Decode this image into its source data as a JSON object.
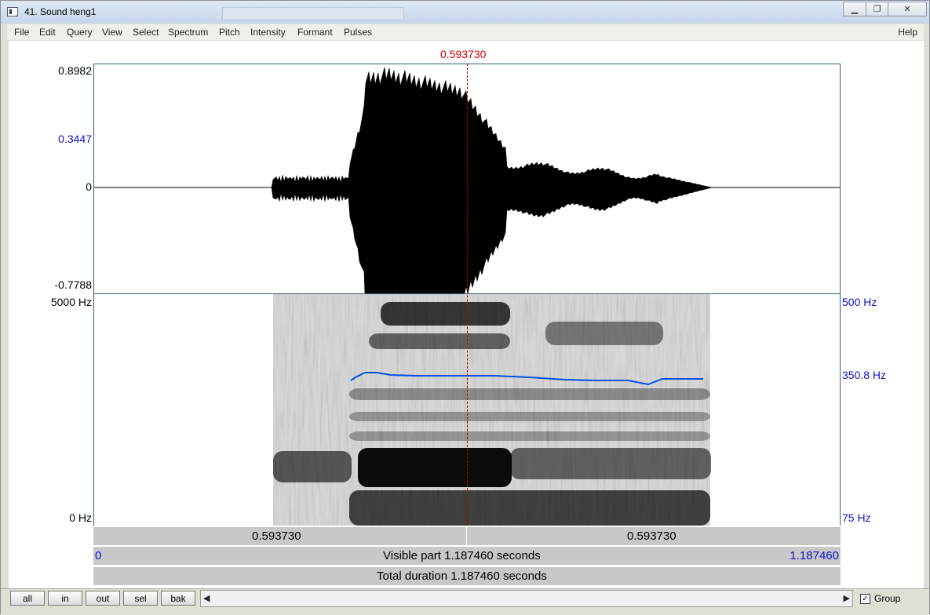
{
  "window": {
    "title": "41. Sound heng1",
    "controls": [
      "minimize",
      "restore",
      "close"
    ]
  },
  "menu": {
    "items": [
      "File",
      "Edit",
      "Query",
      "View",
      "Select",
      "Spectrum",
      "Pitch",
      "Intensity",
      "Formant",
      "Pulses"
    ],
    "help": "Help"
  },
  "cursor": {
    "time_label": "0.593730"
  },
  "waveform": {
    "y_max": "0.8982",
    "y_mid": "0.3447",
    "y_zero": "0",
    "y_min": "-0.7788"
  },
  "spectrogram": {
    "freq_max": "5000 Hz",
    "freq_min": "0 Hz",
    "pitch_max": "500 Hz",
    "pitch_value": "350.8 Hz",
    "pitch_min": "75 Hz"
  },
  "time_bar": {
    "left_segment": "0.593730",
    "right_segment": "0.593730",
    "visible_start": "0",
    "visible_label": "Visible part 1.187460 seconds",
    "visible_end": "1.187460",
    "total_label": "Total duration 1.187460 seconds"
  },
  "buttons": {
    "all": "all",
    "in": "in",
    "out": "out",
    "sel": "sel",
    "bak": "bak"
  },
  "group": {
    "label": "Group",
    "checked": true
  },
  "colors": {
    "cursor": "#d00000",
    "pitch": "#0050e0",
    "axis_blue": "#1010c8"
  },
  "icons": [
    "app-icon",
    "scroll-left-icon",
    "scroll-right-icon",
    "checkbox-checked-icon"
  ]
}
